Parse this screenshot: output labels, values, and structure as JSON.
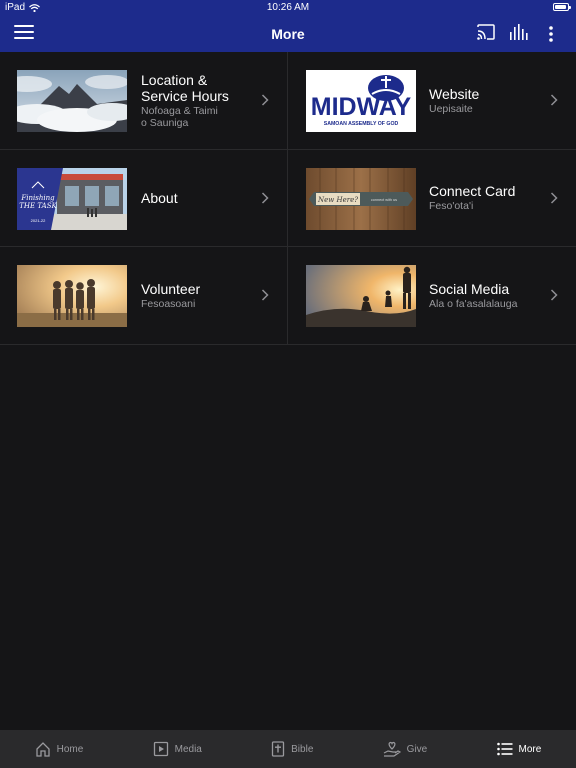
{
  "status": {
    "device": "iPad",
    "time": "10:26 AM"
  },
  "header": {
    "title": "More"
  },
  "items": [
    {
      "title": "Location &\nService Hours",
      "subtitle": "Nofoaga & Taimi\no Sauniga"
    },
    {
      "title": "Website",
      "subtitle": "Uepisaite",
      "logo_text": "MIDWAY",
      "logo_sub": "SAMOAN ASSEMBLY OF GOD"
    },
    {
      "title": "About",
      "subtitle": "",
      "badge_text": "Finishing\nTHE TASK",
      "badge_year": "2021-22"
    },
    {
      "title": "Connect Card",
      "subtitle": "Feso'ota'i",
      "sign_text": "New Here?",
      "sign_sub": "connect with us"
    },
    {
      "title": "Volunteer",
      "subtitle": "Fesoasoani"
    },
    {
      "title": "Social Media",
      "subtitle": "Ala o fa'asalalauga"
    }
  ],
  "tabs": [
    {
      "label": "Home",
      "icon": "home-icon"
    },
    {
      "label": "Media",
      "icon": "media-icon"
    },
    {
      "label": "Bible",
      "icon": "bible-icon"
    },
    {
      "label": "Give",
      "icon": "give-icon"
    },
    {
      "label": "More",
      "icon": "list-icon",
      "active": true
    }
  ],
  "colors": {
    "header": "#1d2b8c",
    "background": "#151517",
    "tabbar": "#2a2a2c",
    "subtitle": "#9a9a9e"
  }
}
